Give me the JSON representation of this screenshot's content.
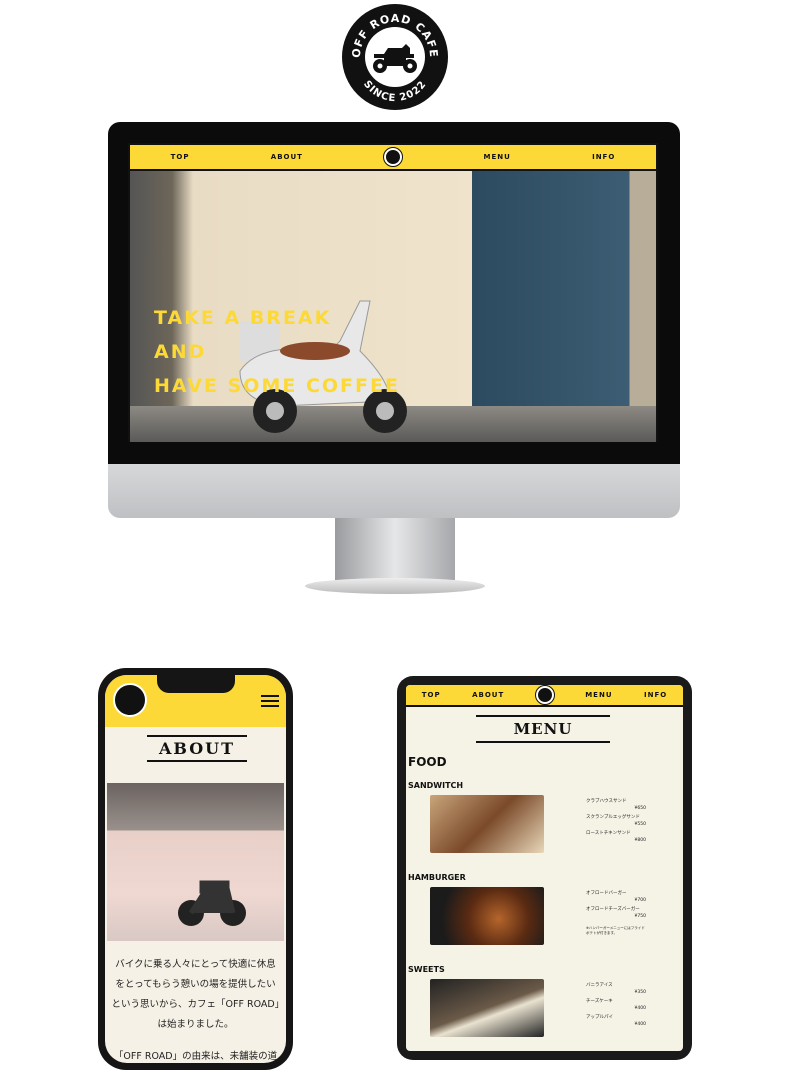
{
  "logo": {
    "top_text": "OFF ROAD CAFE",
    "bottom_text": "SINCE 2022",
    "icon": "motorcycle-icon"
  },
  "desktop": {
    "nav": [
      "TOP",
      "ABOUT",
      "MENU",
      "INFO"
    ],
    "hero_lines": [
      "TAKE A BREAK",
      "AND",
      "HAVE SOME COFFEE"
    ]
  },
  "phone": {
    "title": "ABOUT",
    "paragraphs": [
      "バイクに乗る人々にとって快適に休息をとってもらう憩いの場を提供したいという思いから、カフェ「OFF ROAD」は始まりました。",
      "「OFF ROAD」の由来は、未舗装の道を"
    ]
  },
  "tablet": {
    "nav": [
      "TOP",
      "ABOUT",
      "MENU",
      "INFO"
    ],
    "title": "MENU",
    "section": "FOOD",
    "categories": [
      {
        "name": "SANDWITCH",
        "items": [
          {
            "name": "クラブハウスサンド",
            "price": "¥650"
          },
          {
            "name": "スクランブルエッグサンド",
            "price": "¥550"
          },
          {
            "name": "ローストチキンサンド",
            "price": "¥800"
          }
        ],
        "note": ""
      },
      {
        "name": "HAMBURGER",
        "items": [
          {
            "name": "オフロードバーガー",
            "price": "¥700"
          },
          {
            "name": "オフロードチーズバーガー",
            "price": "¥750"
          }
        ],
        "note": "※ハンバーガーメニューにはフライドポテトが付きます。"
      },
      {
        "name": "SWEETS",
        "items": [
          {
            "name": "バニラアイス",
            "price": "¥350"
          },
          {
            "name": "チーズケーキ",
            "price": "¥400"
          },
          {
            "name": "アップルパイ",
            "price": "¥400"
          }
        ],
        "note": ""
      }
    ]
  },
  "colors": {
    "accent": "#fcd937",
    "dark": "#111111",
    "paper": "#f5f2e6"
  }
}
